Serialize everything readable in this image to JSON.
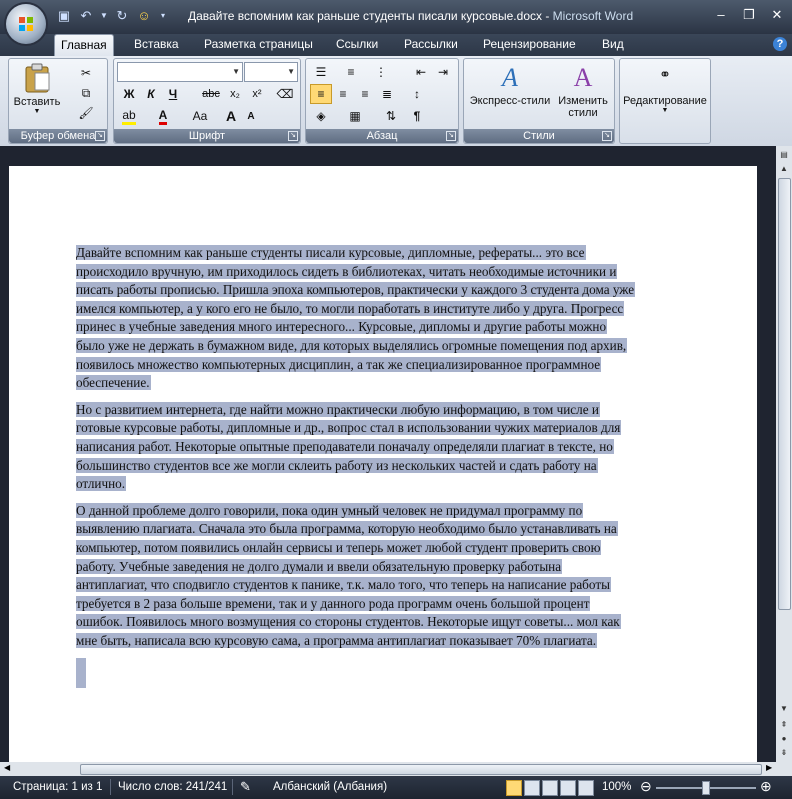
{
  "title": {
    "document": "Давайте вспомним как раньше студенты писали курсовые.docx",
    "separator": " - ",
    "app": "Microsoft Word"
  },
  "tabs": [
    "Главная",
    "Вставка",
    "Разметка страницы",
    "Ссылки",
    "Рассылки",
    "Рецензирование",
    "Вид"
  ],
  "ribbon": {
    "clipboard": {
      "label": "Буфер обмена",
      "paste": "Вставить"
    },
    "font": {
      "label": "Шрифт",
      "bold": "Ж",
      "italic": "К",
      "underline": "Ч",
      "strike": "abc",
      "subscript": "x₂",
      "superscript": "x²",
      "case": "Aa",
      "grow": "A",
      "shrink": "A"
    },
    "paragraph": {
      "label": "Абзац",
      "pilcrow": "¶"
    },
    "styles": {
      "label": "Стили",
      "express": "Экспресс-стили",
      "change_line1": "Изменить",
      "change_line2": "стили"
    },
    "editing": {
      "label": "Редактирование"
    }
  },
  "document": {
    "paragraphs": [
      [
        "Давайте вспомним  как раньше студенты писали курсовые, дипломные, рефераты... это все",
        "происходило вручную, им приходилось  сидеть в библиотеках, читать  необходимые  источники  и",
        "писать работы прописью.  Пришла эпоха  компьютеров, практически у каждого  3 студента дома уже",
        "имелся компьютер,  а у кого его не было,  то могли поработать  в институте либо у друга. Прогресс",
        "принес в учебные заведения много интересного... Курсовые, дипломы  и другие работы можно",
        "было уже не держать в бумажном  виде, для которых  выделялись огромные помещения под архив,",
        "появилось множество  компьютерных  дисциплин, а так же специализированное программное",
        "обеспечение."
      ],
      [
        "Но с развитием интернета, где найти можно практически любую информацию, в том  числе и",
        "готовые курсовые работы,  дипломные  и др., вопрос стал в использовании  чужих материалов для",
        "написания работ.  Некоторые  опытные  преподаватели поначалу определяли плагиат в тексте, но",
        "большинство студентов все же могли склеить работу из нескольких частей и сдать работу на",
        "отлично."
      ],
      [
        "О данной  проблеме долго говорили,  пока один  умный  человек не придумал программу по",
        "выявлению плагиата.  Сначала это была программа, которую необходимо было устанавливать на",
        "компьютер, потом  появились онлайн сервисы и  теперь может любой  студент проверить свою",
        "работу. Учебные заведения не долго думали и ввели обязательную проверку работына",
        "антиплагиат, что сподвигло студентов к панике, т.к. мало того, что  теперь на написание работы",
        "требуется в 2 раза больше времени, так и у данного рода программ очень большой процент",
        "ошибок.  Появилось много возмущения со стороны студентов.  Некоторые ищут советы... мол как",
        "мне быть,  написала всю курсовую сама, а программа антиплагиат показывает 70% плагиата."
      ]
    ]
  },
  "status": {
    "page": "Страница: 1 из 1",
    "words": "Число слов: 241/241",
    "language": "Албанский (Албания)",
    "zoom": "100%"
  },
  "colors": {
    "selection": "#a8b2cc",
    "ribbon_group_label": "#6b7a90",
    "titlebar": "#3a4557"
  }
}
